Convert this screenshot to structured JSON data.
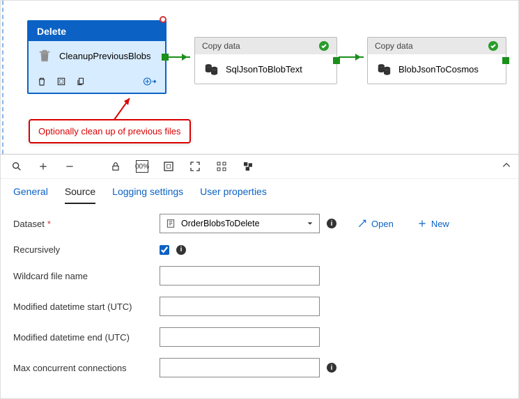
{
  "canvas": {
    "nodes": {
      "delete": {
        "type_label": "Delete",
        "name": "CleanupPreviousBlobs"
      },
      "copy1": {
        "type_label": "Copy data",
        "name": "SqlJsonToBlobText"
      },
      "copy2": {
        "type_label": "Copy data",
        "name": "BlobJsonToCosmos"
      }
    },
    "annotation": "Optionally clean up of previous files"
  },
  "panel": {
    "tabs": {
      "general": "General",
      "source": "Source",
      "logging": "Logging settings",
      "userprops": "User properties"
    },
    "form": {
      "dataset_label": "Dataset",
      "dataset_value": "OrderBlobsToDelete",
      "recursively_label": "Recursively",
      "recursively_checked": true,
      "wildcard_label": "Wildcard file name",
      "wildcard_value": "",
      "mod_start_label": "Modified datetime start (UTC)",
      "mod_start_value": "",
      "mod_end_label": "Modified datetime end (UTC)",
      "mod_end_value": "",
      "max_conn_label": "Max concurrent connections",
      "max_conn_value": "",
      "open_label": "Open",
      "new_label": "New"
    }
  }
}
